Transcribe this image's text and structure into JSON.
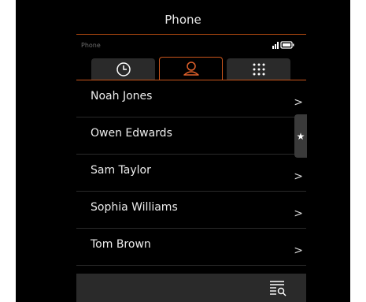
{
  "header": {
    "title": "Phone"
  },
  "status": {
    "app_name": "Phone",
    "signal_icon": "signal-icon",
    "battery_icon": "battery-icon"
  },
  "tabs": [
    {
      "icon": "clock-icon",
      "active": false
    },
    {
      "icon": "person-icon",
      "active": true
    },
    {
      "icon": "keypad-icon",
      "active": false
    }
  ],
  "contacts": [
    {
      "name": "Noah Jones",
      "chevron": ">"
    },
    {
      "name": "Owen Edwards",
      "chevron": ""
    },
    {
      "name": "Sam Taylor",
      "chevron": ">"
    },
    {
      "name": "Sophia Williams",
      "chevron": ">"
    },
    {
      "name": "Tom Brown",
      "chevron": ">"
    }
  ],
  "favorites_tab": {
    "glyph": "★"
  },
  "bottom_bar": {
    "icon": "list-search-icon"
  },
  "colors": {
    "accent": "#c8551c",
    "background": "#000000",
    "surface": "#2a2a2a"
  }
}
